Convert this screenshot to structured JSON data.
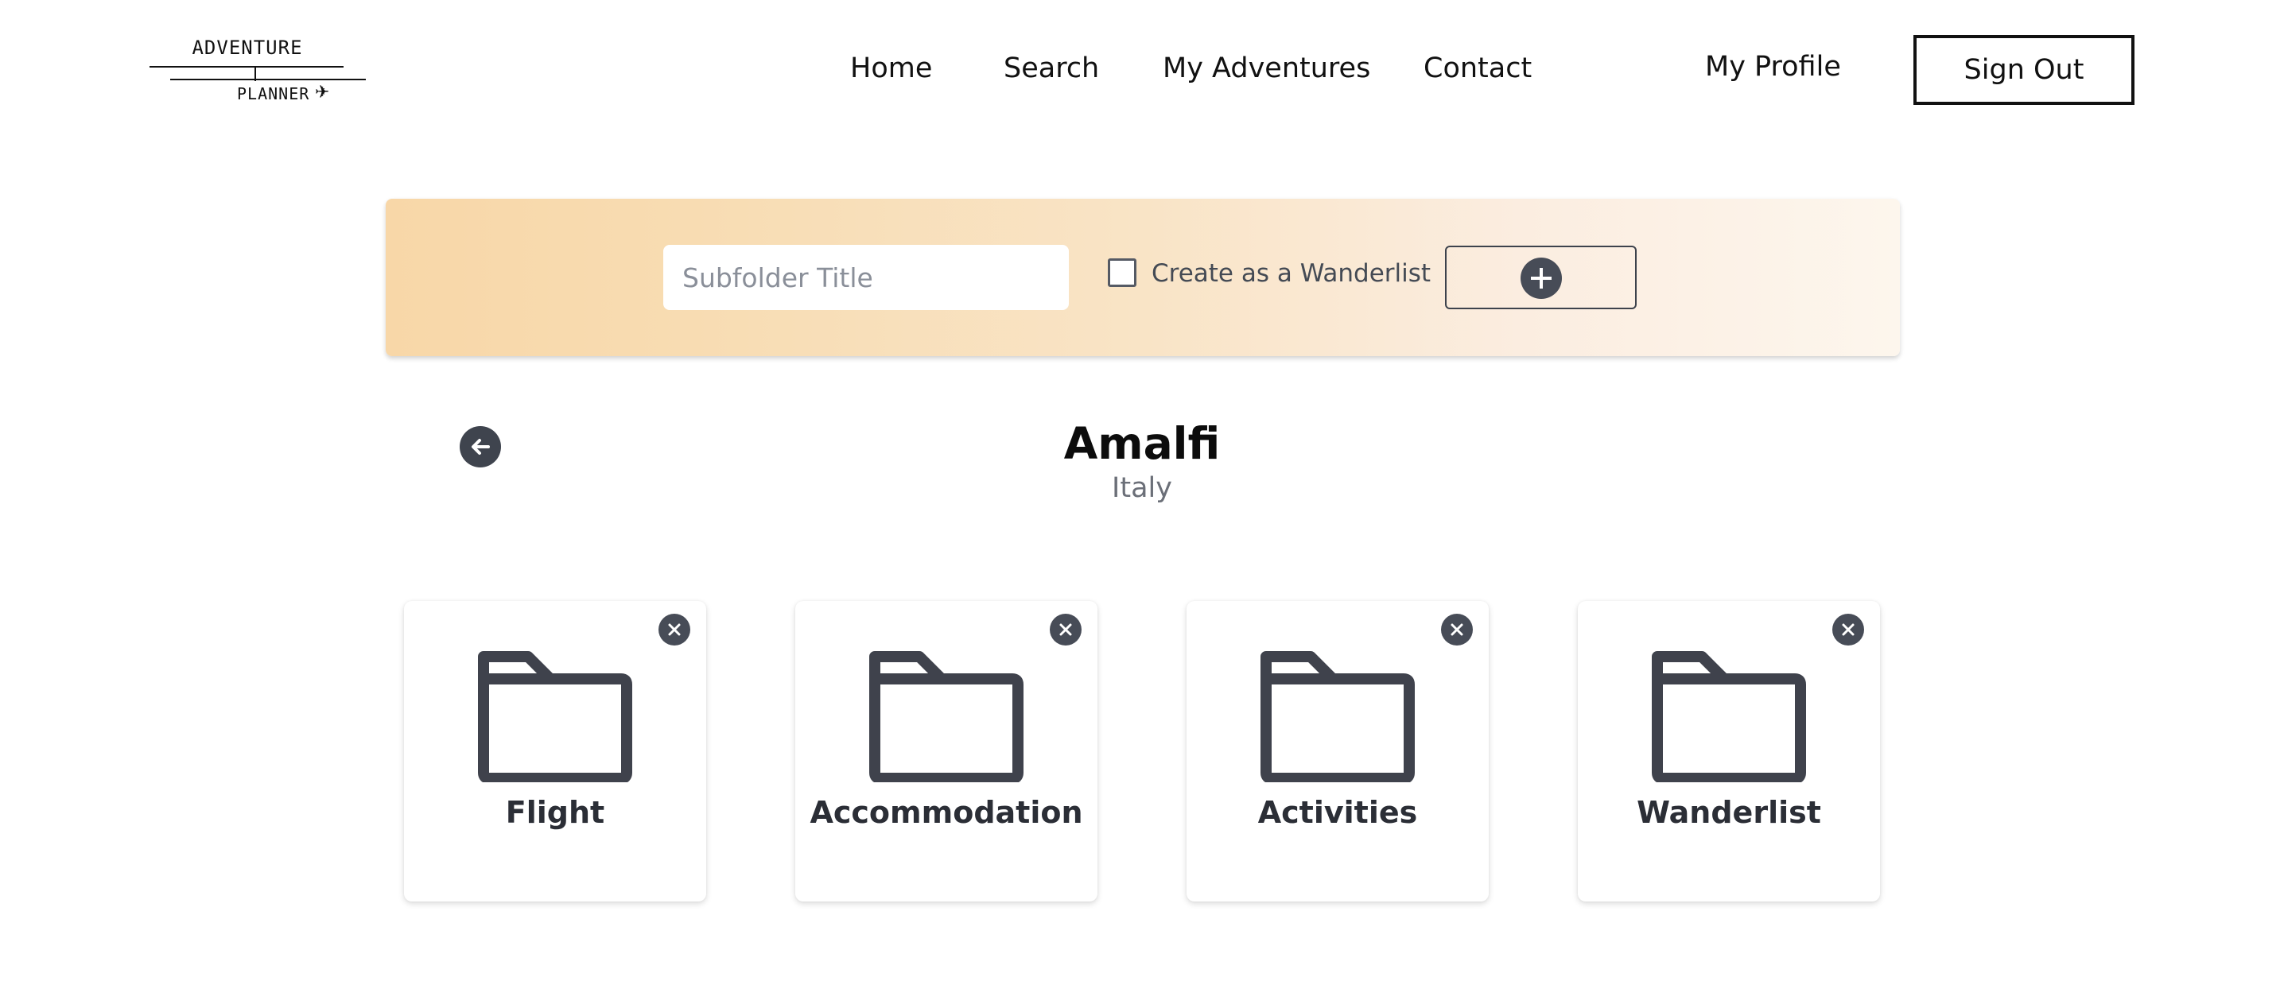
{
  "logo": {
    "line1": "ADVENTURE",
    "line2": "PLANNER",
    "plane_glyph": "✈"
  },
  "nav": {
    "items": [
      {
        "label": "Home"
      },
      {
        "label": "Search"
      },
      {
        "label": "My Adventures"
      },
      {
        "label": "Contact"
      }
    ],
    "profile_label": "My Profile",
    "signout_label": "Sign Out"
  },
  "create_bar": {
    "title_placeholder": "Subfolder Title",
    "title_value": "",
    "wanderlist_checkbox_label": "Create as a Wanderlist",
    "wanderlist_checked": false,
    "add_icon": "plus-circle-icon"
  },
  "location": {
    "title": "Amalfi",
    "subtitle": "Italy",
    "back_icon": "arrow-left-icon"
  },
  "folders": [
    {
      "label": "Flight"
    },
    {
      "label": "Accommodation"
    },
    {
      "label": "Activities"
    },
    {
      "label": "Wanderlist"
    }
  ],
  "colors": {
    "icon_dark": "#3f424c",
    "banner_gradient_start": "#f8d7a8",
    "banner_gradient_end": "#fdf6ed"
  }
}
